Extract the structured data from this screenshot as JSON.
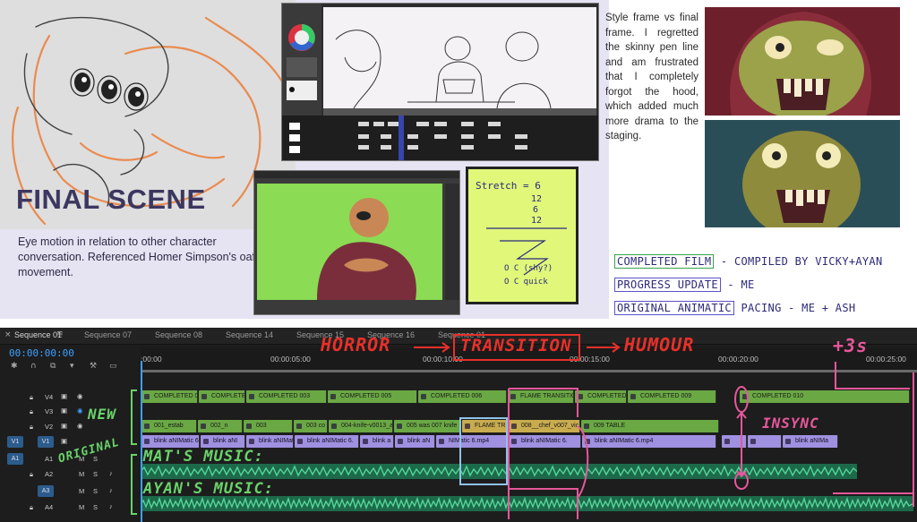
{
  "title": "FINAL SCENE",
  "caption": "Eye motion in relation to other character conversation. Referenced Homer Simpson's oafish movement.",
  "blurb": "Style frame vs final frame. I regretted the skinny pen line and am frustrated that I completely forgot the hood, which added much more drama to the staging.",
  "legend": {
    "completed_film": "COMPLETED FILM",
    "completed_film_note": "- COMPILED BY VICKY+AYAN",
    "progress_update": "PROGRESS UPDATE",
    "progress_update_note": "- ME",
    "original_animatic": "ORIGINAL ANIMATIC",
    "original_animatic_note": "PACING - ME + ASH"
  },
  "sticky_note": {
    "line1": "Stretch = 6",
    "line2": "12",
    "line3": "6",
    "line4": "12",
    "line5": "O C (shy?)",
    "line6": "O C quick"
  },
  "timeline": {
    "tabs": [
      "Sequence 01",
      "Sequence 07",
      "Sequence 08",
      "Sequence 14",
      "Sequence 15",
      "Sequence 16",
      "Sequence 01"
    ],
    "timecode": "00:00:00:00",
    "ruler": [
      ":00:00",
      "00:00:05:00",
      "00:00:10:00",
      "00:00:15:00",
      "00:00:20:00",
      "00:00:25:00"
    ],
    "tracks": {
      "v4": "V4",
      "v3": "V3",
      "v2": "V2",
      "v1": "V1",
      "a1": "A1",
      "a2": "A2",
      "a3": "A3",
      "a4": "A4",
      "src_v1": "V1",
      "src_a1": "A1",
      "m": "M",
      "s": "S"
    },
    "v4_clips": [
      "COMPLETED 00",
      "COMPLETE",
      "COMPLETED 003",
      "COMPLETED 005",
      "COMPLETED 006",
      "FLAME TRANSITIO",
      "COMPLETED",
      "COMPLETED 009",
      "COMPLETED 010"
    ],
    "v2_clips": [
      "001_estab",
      "002_n",
      "003",
      "003 co",
      "004-knife-v0013_a",
      "005 was 007 knife",
      "FLAME TR",
      "008__chef_v007_vic",
      "009 TABLE"
    ],
    "v1_clips": [
      "blink aNIMatic 6.",
      "blink aNI",
      "blink aNIMat",
      "blink aNIMatic 6.",
      "blink a",
      "blink aN",
      "NIMatic 6.mp4",
      "blink aNIMatic 6.",
      "blink aNIMatic 6.mp4",
      "blink aNIMa"
    ]
  },
  "annotations": {
    "horror": "HORROR",
    "transition": "TRANSITION",
    "humour": "HUMOUR",
    "plus3s": "+3s",
    "new": "NEW",
    "original": "ORIGINAL",
    "mats_music": "MAT'S MUSIC:",
    "ayans_music": "AYAN'S MUSIC:",
    "insync": "INSYNC"
  },
  "colors": {
    "title": "#3c3760",
    "green_clip": "#6aa844",
    "purple_clip": "#9f90e0",
    "annotation_red": "#e8302a",
    "annotation_pink": "#e6579a",
    "annotation_green": "#69d36a",
    "annotation_blue": "#8fc3ea",
    "waveform": "#3fc58c"
  }
}
